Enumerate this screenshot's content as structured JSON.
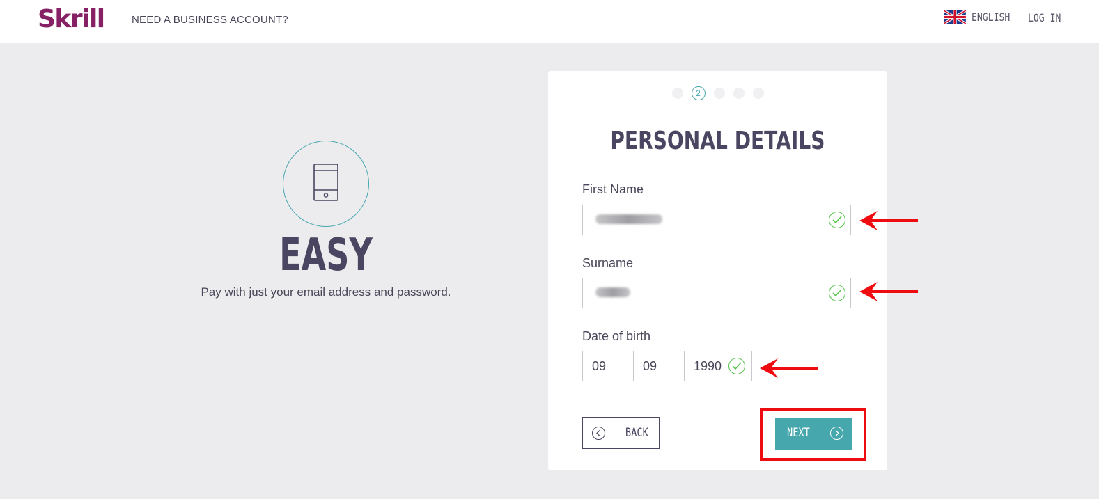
{
  "header": {
    "logo_text": "Skrill",
    "business_link": "NEED A BUSINESS ACCOUNT?",
    "language_label": "ENGLISH",
    "login_label": "LOG IN",
    "flag_icon": "uk-flag-icon"
  },
  "hero": {
    "icon": "smartphone-icon",
    "title": "EASY",
    "subtitle": "Pay with just your email address and password."
  },
  "form": {
    "active_step": "2",
    "step_count": 5,
    "title": "PERSONAL DETAILS",
    "first_name_label": "First Name",
    "surname_label": "Surname",
    "dob_label": "Date of birth",
    "dob_day": "09",
    "dob_month": "09",
    "dob_year": "1990",
    "back_label": "BACK",
    "next_label": "NEXT"
  },
  "colors": {
    "brand": "#862165",
    "accent": "#46a7ad",
    "valid": "#56c44b",
    "annotation": "#ee0c10",
    "text": "#4a4560"
  }
}
